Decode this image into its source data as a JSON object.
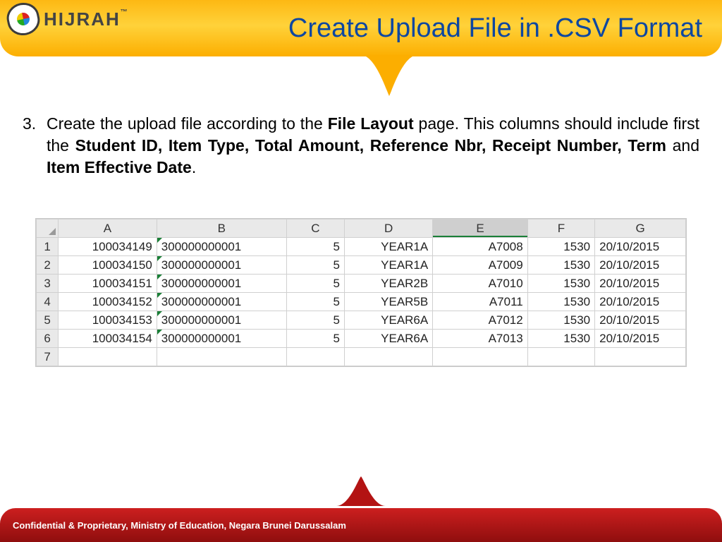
{
  "header": {
    "logo_text": "HIJRAH",
    "logo_tm": "™",
    "title": "Create Upload File in .CSV Format"
  },
  "instruction": {
    "number": "3.",
    "text_before_bold1": "Create the upload file according to the ",
    "bold1": "File Layout",
    "text_mid": " page. This columns should include first the ",
    "bold2": "Student ID, Item Type, Total Amount, Reference Nbr, Receipt Number, Term",
    "text_and": " and ",
    "bold3": "Item Effective Date",
    "text_end": "."
  },
  "sheet": {
    "columns": [
      "A",
      "B",
      "C",
      "D",
      "E",
      "F",
      "G"
    ],
    "selected_column_index": 4,
    "row_numbers": [
      "1",
      "2",
      "3",
      "4",
      "5",
      "6",
      "7"
    ],
    "rows": [
      {
        "A": "100034149",
        "B": "300000000001",
        "C": "5",
        "D": "YEAR1A",
        "E": "A7008",
        "F": "1530",
        "G": "20/10/2015"
      },
      {
        "A": "100034150",
        "B": "300000000001",
        "C": "5",
        "D": "YEAR1A",
        "E": "A7009",
        "F": "1530",
        "G": "20/10/2015"
      },
      {
        "A": "100034151",
        "B": "300000000001",
        "C": "5",
        "D": "YEAR2B",
        "E": "A7010",
        "F": "1530",
        "G": "20/10/2015"
      },
      {
        "A": "100034152",
        "B": "300000000001",
        "C": "5",
        "D": "YEAR5B",
        "E": "A7011",
        "F": "1530",
        "G": "20/10/2015"
      },
      {
        "A": "100034153",
        "B": "300000000001",
        "C": "5",
        "D": "YEAR6A",
        "E": "A7012",
        "F": "1530",
        "G": "20/10/2015"
      },
      {
        "A": "100034154",
        "B": "300000000001",
        "C": "5",
        "D": "YEAR6A",
        "E": "A7013",
        "F": "1530",
        "G": "20/10/2015"
      }
    ]
  },
  "footer": {
    "text": "Confidential & Proprietary, Ministry of Education, Negara Brunei Darussalam"
  }
}
